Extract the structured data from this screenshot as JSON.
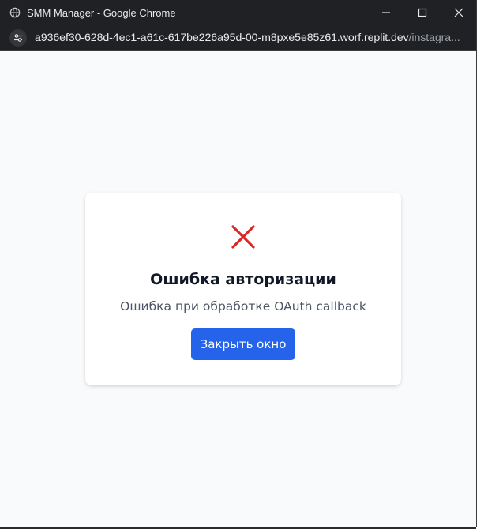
{
  "window": {
    "title": "SMM Manager - Google Chrome",
    "url_host": "a936ef30-628d-4ec1-a61c-617be226a95d-00-m8pxe5e85z61.worf.replit.dev",
    "url_path": "/instagra..."
  },
  "dialog": {
    "icon": "x-mark-icon",
    "title": "Ошибка авторизации",
    "message": "Ошибка при обработке OAuth callback",
    "button_label": "Закрыть окно"
  },
  "colors": {
    "error": "#dc2626",
    "primary": "#2563eb",
    "title_bar": "#202124"
  }
}
